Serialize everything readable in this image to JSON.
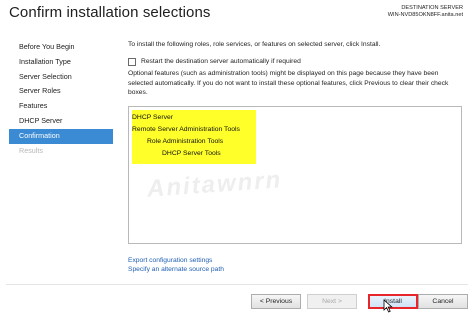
{
  "window": {
    "title": "Confirm installation selections",
    "destination_label": "DESTINATION SERVER",
    "destination_server": "WIN-NVD85OKN8FF.anita.net"
  },
  "nav": {
    "items": [
      {
        "label": "Before You Begin",
        "state": "normal"
      },
      {
        "label": "Installation Type",
        "state": "normal"
      },
      {
        "label": "Server Selection",
        "state": "normal"
      },
      {
        "label": "Server Roles",
        "state": "normal"
      },
      {
        "label": "Features",
        "state": "normal"
      },
      {
        "label": "DHCP Server",
        "state": "normal"
      },
      {
        "label": "Confirmation",
        "state": "active"
      },
      {
        "label": "Results",
        "state": "disabled"
      }
    ]
  },
  "main": {
    "intro": "To install the following roles, role services, or features on selected server, click Install.",
    "restart_label": "Restart the destination server automatically if required",
    "restart_checked": false,
    "optional_text": "Optional features (such as administration tools) might be displayed on this page because they have been selected automatically. If you do not want to install these optional features, click Previous to clear their check boxes.",
    "features": [
      "DHCP Server",
      "Remote Server Administration Tools",
      "Role Administration Tools",
      "DHCP Server Tools"
    ],
    "watermark": "Anitawnrn",
    "export_link": "Export configuration settings",
    "source_link": "Specify an alternate source path"
  },
  "buttons": {
    "previous": "< Previous",
    "next": "Next >",
    "install": "Install",
    "cancel": "Cancel"
  },
  "colors": {
    "accent": "#3a8bd3",
    "highlight": "#ffff29",
    "install_outline": "#e6262a",
    "link": "#1f5fb3"
  }
}
